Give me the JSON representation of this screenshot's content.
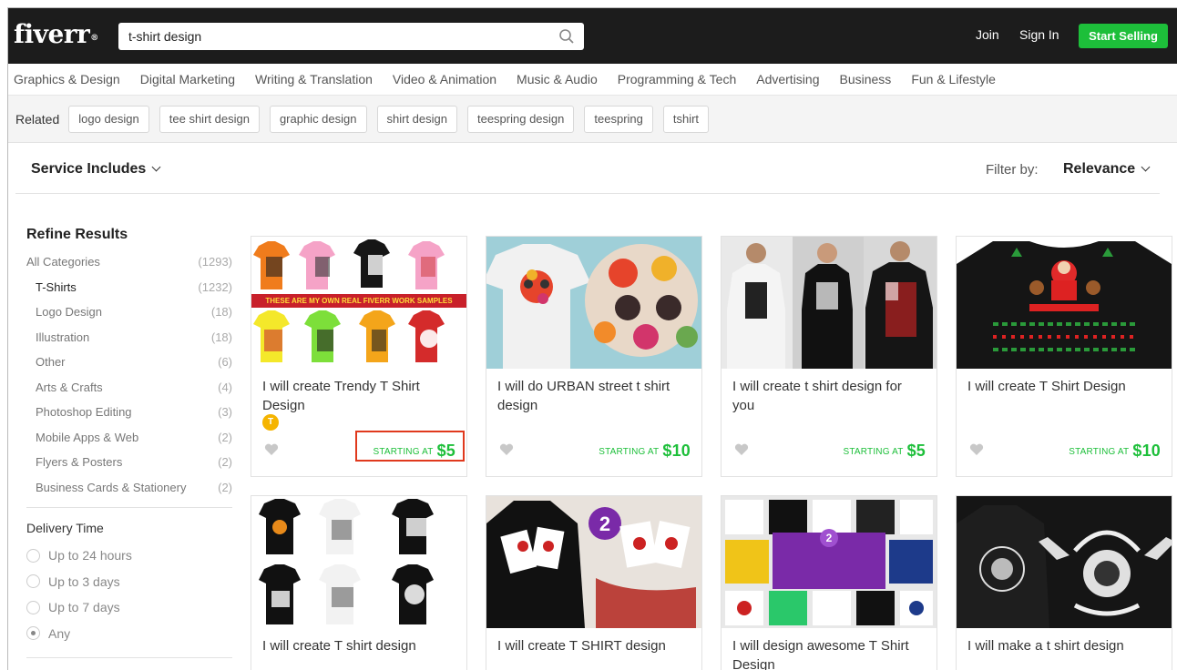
{
  "header": {
    "logo": "fiverr",
    "search_value": "t-shirt design",
    "join": "Join",
    "sign_in": "Sign In",
    "start_selling": "Start Selling"
  },
  "categories": [
    "Graphics & Design",
    "Digital Marketing",
    "Writing & Translation",
    "Video & Animation",
    "Music & Audio",
    "Programming & Tech",
    "Advertising",
    "Business",
    "Fun & Lifestyle"
  ],
  "related": {
    "label": "Related",
    "tags": [
      "logo design",
      "tee shirt design",
      "graphic design",
      "shirt design",
      "teespring design",
      "teespring",
      "tshirt"
    ]
  },
  "filterbar": {
    "service_includes": "Service Includes",
    "filter_label": "Filter by:",
    "filter_value": "Relevance"
  },
  "sidebar": {
    "title": "Refine Results",
    "categories": [
      {
        "label": "All Categories",
        "count": "(1293)"
      },
      {
        "label": "T-Shirts",
        "count": "(1232)"
      },
      {
        "label": "Logo Design",
        "count": "(18)"
      },
      {
        "label": "Illustration",
        "count": "(18)"
      },
      {
        "label": "Other",
        "count": "(6)"
      },
      {
        "label": "Arts & Crafts",
        "count": "(4)"
      },
      {
        "label": "Photoshop Editing",
        "count": "(3)"
      },
      {
        "label": "Mobile Apps & Web",
        "count": "(2)"
      },
      {
        "label": "Flyers & Posters",
        "count": "(2)"
      },
      {
        "label": "Business Cards & Stationery",
        "count": "(2)"
      }
    ],
    "delivery_title": "Delivery Time",
    "delivery_options": [
      "Up to 24 hours",
      "Up to 3 days",
      "Up to 7 days",
      "Any"
    ],
    "delivery_selected": "Any"
  },
  "gigs": [
    {
      "title": "I will create Trendy T Shirt Design",
      "starting": "STARTING AT",
      "price": "$5",
      "banner": "THESE ARE MY OWN REAL FIVERR WORK SAMPLES",
      "badge": "T"
    },
    {
      "title": "I will do URBAN street t shirt design",
      "starting": "STARTING AT",
      "price": "$10"
    },
    {
      "title": "I will create t shirt design for you",
      "starting": "STARTING AT",
      "price": "$5"
    },
    {
      "title": "I will create T Shirt Design",
      "starting": "STARTING AT",
      "price": "$10"
    },
    {
      "title": "I will create T shirt design"
    },
    {
      "title": "I will create T SHIRT design"
    },
    {
      "title": "I will design awesome T Shirt Design"
    },
    {
      "title": "I will make a t shirt design"
    }
  ],
  "colors": {
    "brand_green": "#1dbf3a",
    "header_bg": "#1c1c1c",
    "highlight_red": "#e0391d"
  }
}
